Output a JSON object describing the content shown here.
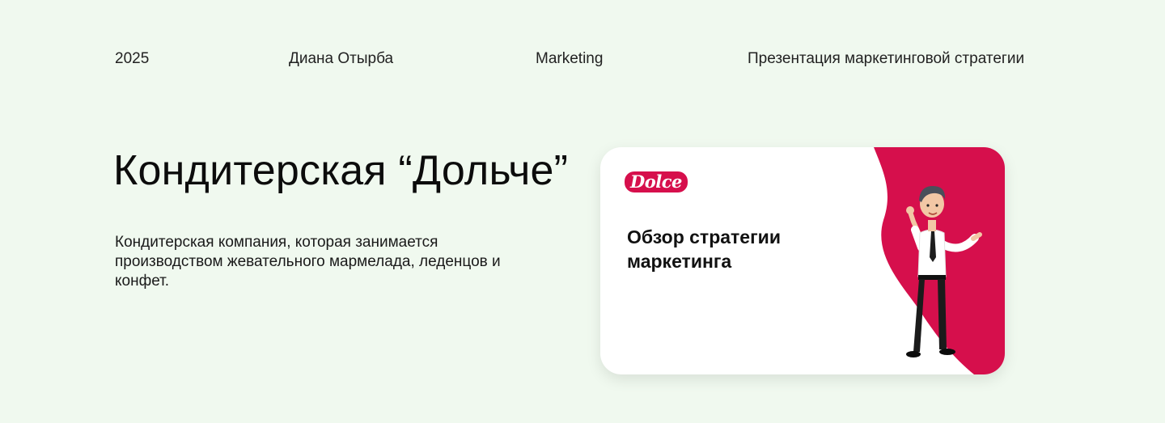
{
  "header": {
    "year": "2025",
    "author": "Диана Отырба",
    "category": "Marketing",
    "subject": "Презентация маркетинговой стратегии"
  },
  "main": {
    "title": "Кондитерская “Дольче”",
    "description": "Кондитерская компания, которая занимается производством жевательного мармелада, леденцов и конфет."
  },
  "card": {
    "logo_text": "Dolce",
    "title": "Обзор стратегии маркетинга",
    "illustration": "businessman-illustration",
    "accent_color": "#d60f4c"
  }
}
